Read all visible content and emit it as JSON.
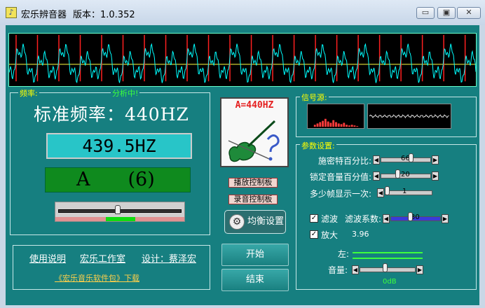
{
  "window": {
    "title": "宏乐辨音器",
    "version": "版本：1.0.352",
    "icon": "music-note-icon",
    "controls": {
      "minimize": "▭",
      "restore": "▣",
      "close": "✕"
    }
  },
  "freq_panel": {
    "label": "频率:",
    "status": "分析中!",
    "standard": "标准频率：440HZ",
    "measured": "439.5HZ",
    "note": "A　　(6)",
    "deviation": 0.48
  },
  "links": {
    "manual": "使用说明",
    "studio": "宏乐工作室",
    "design": "设计：蔡泽宏",
    "download": "《宏乐音乐软件包》下载"
  },
  "center": {
    "reference": "A=440HZ",
    "playback_panel": "播放控制板",
    "record_panel": "录音控制板",
    "equalizer": "均衡设置",
    "start": "开始",
    "stop": "结束"
  },
  "signal": {
    "label": "信号源:"
  },
  "params": {
    "label": "参数设置:",
    "schmitt": {
      "label": "施密特百分比:",
      "value": "66",
      "level": 0.62
    },
    "lock": {
      "label": "锁定音量百分值:",
      "value": "20",
      "level": 0.32
    },
    "frames": {
      "label": "多少帧显示一次:",
      "value": "1",
      "level": 0.0
    },
    "filter": {
      "label": "滤波",
      "checked": true,
      "coef_label": "滤波系数:",
      "coef_value": "30",
      "level": 0.38
    },
    "amplify": {
      "label": "放大",
      "checked": true,
      "value": "3.96"
    },
    "left_label": "左:",
    "volume_label": "音量:",
    "volume_db": "0dB",
    "volume_level": 0.45
  },
  "colors": {
    "panel": "#167f80",
    "label": "#ffff00",
    "wave": "#00ffff",
    "marker": "#ff2020"
  }
}
